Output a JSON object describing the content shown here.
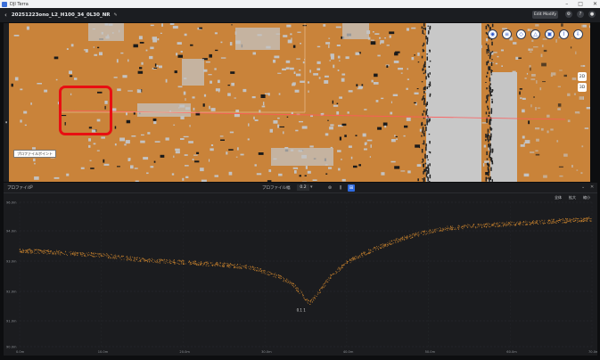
{
  "os_bar": {
    "title": "DJI Terra",
    "min": "–",
    "max": "□",
    "close": "✕"
  },
  "header": {
    "file_name": "20251223ono_L2_H100_34_0L30_NR",
    "edit_label": "Edit Modify"
  },
  "viewport": {
    "measure_label": "プロファイルポイント",
    "side_btn_top": "2D",
    "side_btn_bottom": "3D",
    "ground_color": "#c9833a",
    "bare_color": "#c3c3c3",
    "highlight_color": "#e80f12"
  },
  "profile": {
    "title": "プロファイル",
    "interval_label": "プロファイル幅",
    "interval_value": "0.2",
    "zoom_buttons": [
      "全体",
      "拡大",
      "縮小"
    ],
    "annotation": "0.1 1",
    "point_color": "#c9832e"
  },
  "chart_data": {
    "type": "scatter",
    "yticks": [
      "96.0m",
      "94.0m",
      "93.0m",
      "92.0m",
      "91.0m",
      "90.0m"
    ],
    "xticks": [
      "0.0m",
      "10.0m",
      "20.0m",
      "30.0m",
      "40.0m",
      "50.0m",
      "60.0m",
      "70.0m"
    ],
    "ylim": [
      90.0,
      96.0
    ],
    "xlim": [
      0.0,
      70.0
    ],
    "profile_points": [
      [
        0,
        94.0
      ],
      [
        5,
        93.9
      ],
      [
        10,
        93.8
      ],
      [
        15,
        93.6
      ],
      [
        20,
        93.5
      ],
      [
        25,
        93.4
      ],
      [
        28,
        93.3
      ],
      [
        31,
        93.0
      ],
      [
        33,
        92.7
      ],
      [
        34.5,
        92.2
      ],
      [
        35.5,
        91.8
      ],
      [
        36.5,
        92.2
      ],
      [
        38,
        92.9
      ],
      [
        40,
        93.5
      ],
      [
        43,
        94.0
      ],
      [
        46,
        94.4
      ],
      [
        49,
        94.7
      ],
      [
        52,
        94.9
      ],
      [
        55,
        95.0
      ],
      [
        60,
        95.1
      ],
      [
        65,
        95.2
      ],
      [
        70,
        95.3
      ]
    ]
  }
}
